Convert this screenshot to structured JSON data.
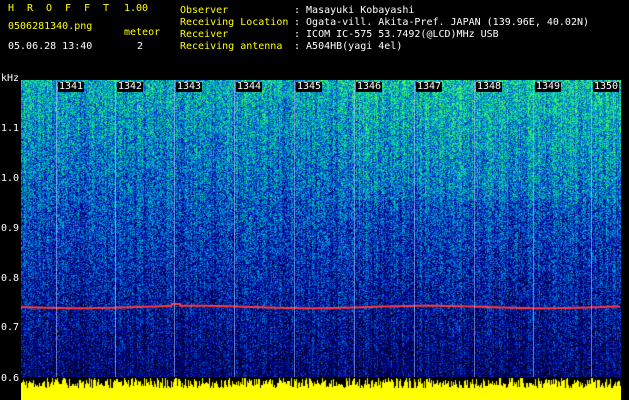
{
  "app": {
    "title_letters": [
      "H",
      "R",
      "O",
      "F",
      "F",
      "T"
    ],
    "version": "1.00",
    "filename": "0506281340.png",
    "datetime": "05.06.28 13:40",
    "meteor_label": "meteor",
    "meteor_count": "2"
  },
  "info": [
    {
      "label": "Observer",
      "value": ": Masayuki Kobayashi"
    },
    {
      "label": "Receiving Location",
      "value": ": Ogata-vill. Akita-Pref. JAPAN (139.96E, 40.02N)"
    },
    {
      "label": "Receiver",
      "value": ": ICOM IC-575 53.7492(@LCD)MHz USB"
    },
    {
      "label": "Receiving antenna",
      "value": ": A504HB(yagi 4el)"
    }
  ],
  "y_axis": {
    "unit": "kHz",
    "ticks": [
      "1.1",
      "1.0",
      "0.9",
      "0.8",
      "0.7",
      "0.6"
    ]
  },
  "x_axis": {
    "minutes": [
      "1341",
      "1342",
      "1343",
      "1344",
      "1345",
      "1346",
      "1347",
      "1348",
      "1349",
      "1350"
    ]
  },
  "colors": {
    "background": "#000000",
    "label": "#ffff00",
    "value": "#ffffff",
    "carrier": "#ff3b3b",
    "meteor_band": "#ffff00"
  }
}
